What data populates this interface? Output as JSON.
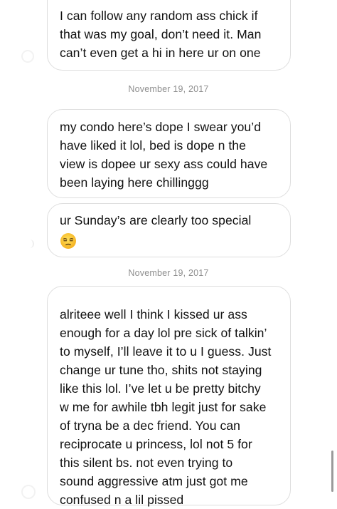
{
  "messages": [
    {
      "lines": [
        "I can follow any random ass chick if",
        "that was my goal, don’t need it. Man",
        "can’t even get a hi in here ur on one"
      ]
    },
    {
      "lines": [
        "my condo here’s dope I swear you’d",
        "have liked it lol, bed is dope n the",
        "view is dopee ur sexy ass could have",
        "been laying here chillinggg"
      ]
    },
    {
      "lines": [
        "ur Sunday’s are clearly too special"
      ],
      "emoji": "unamused-face"
    },
    {
      "lines": [
        "alriteee well I think I kissed ur ass",
        "enough for a day lol pre sick of talkin’",
        "to myself, I’ll leave it to u I guess. Just",
        "change ur tune tho, shits not staying",
        "like this lol. I’ve let u be pretty bitchy",
        "w me for awhile tbh legit just for sake",
        "of tryna be a dec friend. You can",
        "reciprocate u princess, lol not 5 for",
        "this silent bs. not even trying to",
        "sound aggressive atm just got me",
        "confused n a lil pissed"
      ]
    }
  ],
  "dates": [
    "November 19, 2017",
    "November 19, 2017"
  ],
  "colors": {
    "bubble_border": "#dedede",
    "text": "#111111",
    "date_text": "#8e8e8e"
  }
}
